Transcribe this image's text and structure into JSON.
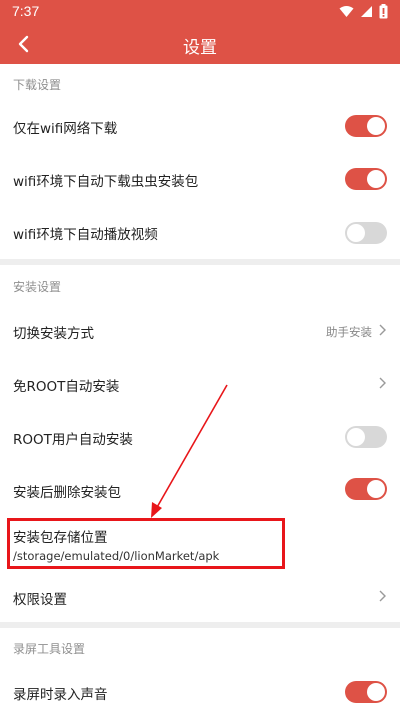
{
  "status_bar": {
    "time": "7:37"
  },
  "app_bar": {
    "title": "设置"
  },
  "sections": {
    "download": {
      "header": "下载设置",
      "items": [
        {
          "label": "仅在wifi网络下载",
          "toggle": "on"
        },
        {
          "label": "wifi环境下自动下载虫虫安装包",
          "toggle": "on"
        },
        {
          "label": "wifi环境下自动播放视频",
          "toggle": "off"
        }
      ]
    },
    "install": {
      "header": "安装设置",
      "items": [
        {
          "label": "切换安装方式",
          "value": "助手安装"
        },
        {
          "label": "免ROOT自动安装"
        },
        {
          "label": "ROOT用户自动安装",
          "toggle": "off"
        },
        {
          "label": "安装后删除安装包",
          "toggle": "on"
        },
        {
          "label": "安装包存储位置",
          "sub": "/storage/emulated/0/lionMarket/apk"
        },
        {
          "label": "权限设置"
        }
      ]
    },
    "record": {
      "header": "录屏工具设置",
      "items": [
        {
          "label": "录屏时录入声音",
          "toggle": "on"
        }
      ]
    }
  },
  "colors": {
    "accent": "#de5246",
    "toggle_off": "#d8d8d8",
    "annotation": "#e8161a"
  },
  "icons": {
    "back": "chevron-left-icon",
    "wifi": "wifi-icon",
    "signal": "signal-icon",
    "battery": "battery-icon"
  }
}
